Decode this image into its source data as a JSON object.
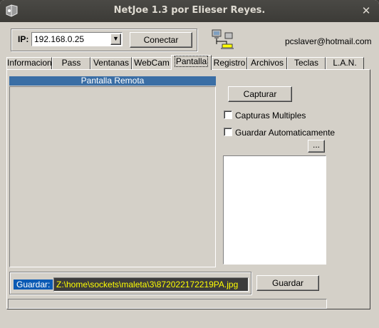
{
  "window": {
    "title": "NetJoe 1.3 por Elieser Reyes."
  },
  "connection": {
    "ip_label": "IP:",
    "ip_value": "192.168.0.25",
    "connect_label": "Conectar",
    "email": "pcslaver@hotmail.com"
  },
  "tabs": [
    {
      "label": "Informacion"
    },
    {
      "label": "Pass"
    },
    {
      "label": "Ventanas"
    },
    {
      "label": "WebCam"
    },
    {
      "label": "Pantalla"
    },
    {
      "label": "Registro"
    },
    {
      "label": "Archivos"
    },
    {
      "label": "Teclas"
    },
    {
      "label": "L.A.N."
    }
  ],
  "active_tab": "Pantalla",
  "screen_panel": {
    "header": "Pantalla Remota",
    "capture_label": "Capturar",
    "multiple_label": "Capturas Multiples",
    "autosave_label": "Guardar Automaticamente",
    "browse_label": "...",
    "save_path_label": "Guardar:",
    "save_path_value": "Z:\\home\\sockets\\maleta\\3\\872022172219PA.jpg",
    "save_label": "Guardar"
  },
  "colors": {
    "header_bg": "#3a6ea5",
    "path_bg": "#3c3c3c",
    "path_text": "#ffff00",
    "label_bg": "#0a5ab4"
  }
}
